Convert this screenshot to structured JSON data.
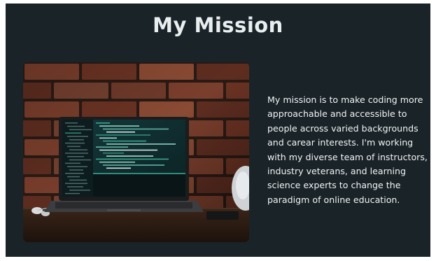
{
  "section": {
    "title": "My Mission",
    "body": "My mission is to make coding more approachable and accessible to people across varied backgrounds and carear interests. I'm working with my diverse team of instructors, industry veterans, and learning science experts to change the paradigm of online education."
  },
  "image": {
    "icon": "laptop-photo",
    "colors": {
      "background": "#192328",
      "brick": "#7a3e2c",
      "mortar": "#2a1a14",
      "screen": "#0f2a2c",
      "accent": "#2f8c7c"
    }
  }
}
